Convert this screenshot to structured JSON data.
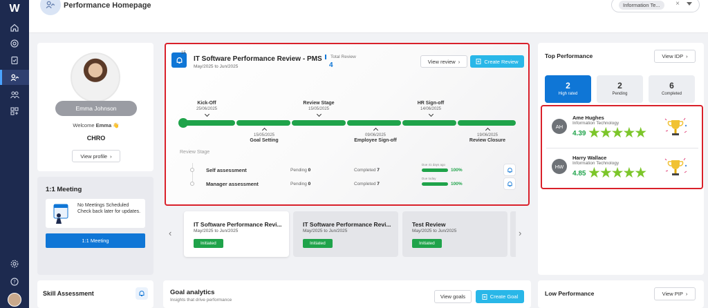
{
  "app": {
    "logo": "W",
    "page_title": "Performance Homepage",
    "department_filter": {
      "selected": "Information Te...",
      "clear": "×"
    }
  },
  "sidebar": {
    "icons": [
      "home-icon",
      "target-icon",
      "clipboard-check-icon",
      "user-trend-icon",
      "team-icon",
      "grid-plus-icon",
      "settings-icon",
      "help-icon"
    ],
    "active": "user-trend-icon"
  },
  "profile": {
    "name": "Emma Johnson",
    "welcome_prefix": "Welcome",
    "welcome_name": "Emma",
    "welcome_emoji": "👋",
    "role": "CHRO",
    "view_profile": "View profile"
  },
  "meeting": {
    "title": "1:1 Meeting",
    "line1": "No Meetings Scheduled",
    "line2": "Check back later for updates.",
    "button": "1:1 Meeting"
  },
  "skill": {
    "title": "Skill Assessment"
  },
  "review": {
    "badge_count": "15",
    "title": "IT Software Performance Review - PMS",
    "date_range": "May/2025 to Jun/2025",
    "total_label": "Total Review",
    "total_value": "4",
    "view_button": "View review",
    "create_button": "Create Review",
    "stages_top": [
      {
        "title": "Kick-Off",
        "date": "25/06/2025"
      },
      {
        "title": "Review Stage",
        "date": "15/05/2025"
      },
      {
        "title": "HR Sign-off",
        "date": "14/06/2025"
      }
    ],
    "stages_bottom": [
      {
        "title": "Goal Setting",
        "date": "15/05/2025"
      },
      {
        "title": "Employee Sign-off",
        "date": "09/06/2025"
      },
      {
        "title": "Review Closure",
        "date": "19/06/2025"
      }
    ],
    "review_stage_label": "Review Stage",
    "assessments": [
      {
        "name": "Self assessment",
        "pending_label": "Pending",
        "pending": "0",
        "completed_label": "Completed",
        "completed": "7",
        "note": "Due 41 days ago",
        "percent": "100%"
      },
      {
        "name": "Manager assessment",
        "pending_label": "Pending",
        "pending": "0",
        "completed_label": "Completed",
        "completed": "7",
        "note": "Due today",
        "percent": "100%"
      }
    ]
  },
  "carousel": [
    {
      "title": "IT Software Performance Revi...",
      "date": "May/2025 to Jun/2025",
      "status": "Initiated"
    },
    {
      "title": "IT Software Performance Revi...",
      "date": "May/2025 to Jun/2025",
      "status": "Initiated"
    },
    {
      "title": "Test Review",
      "date": "May/2025 to Jun/2025",
      "status": "Initiated"
    }
  ],
  "goals": {
    "title": "Goal analytics",
    "subtitle": "Insights that drive performance",
    "view_button": "View goals",
    "create_button": "Create Goal"
  },
  "top_performance": {
    "title": "Top Performance",
    "view_button": "View IDP",
    "tabs": [
      {
        "count": "2",
        "label": "High rated"
      },
      {
        "count": "2",
        "label": "Pending"
      },
      {
        "count": "6",
        "label": "Completed"
      }
    ],
    "people": [
      {
        "initials": "AH",
        "name": "Ame Hughes",
        "dept": "Information Technology",
        "score": "4.39",
        "stars": "★★★★★"
      },
      {
        "initials": "HW",
        "name": "Harry Wallace",
        "dept": "Information Technology",
        "score": "4.85",
        "stars": "★★★★★"
      }
    ]
  },
  "low_performance": {
    "title": "Low Performance",
    "view_button": "View PIP"
  },
  "colors": {
    "sidebar": "#1d2a4f",
    "primary": "#0f76d6",
    "accent": "#29b7e8",
    "success": "#1fa34a",
    "highlight": "#d9202a"
  }
}
